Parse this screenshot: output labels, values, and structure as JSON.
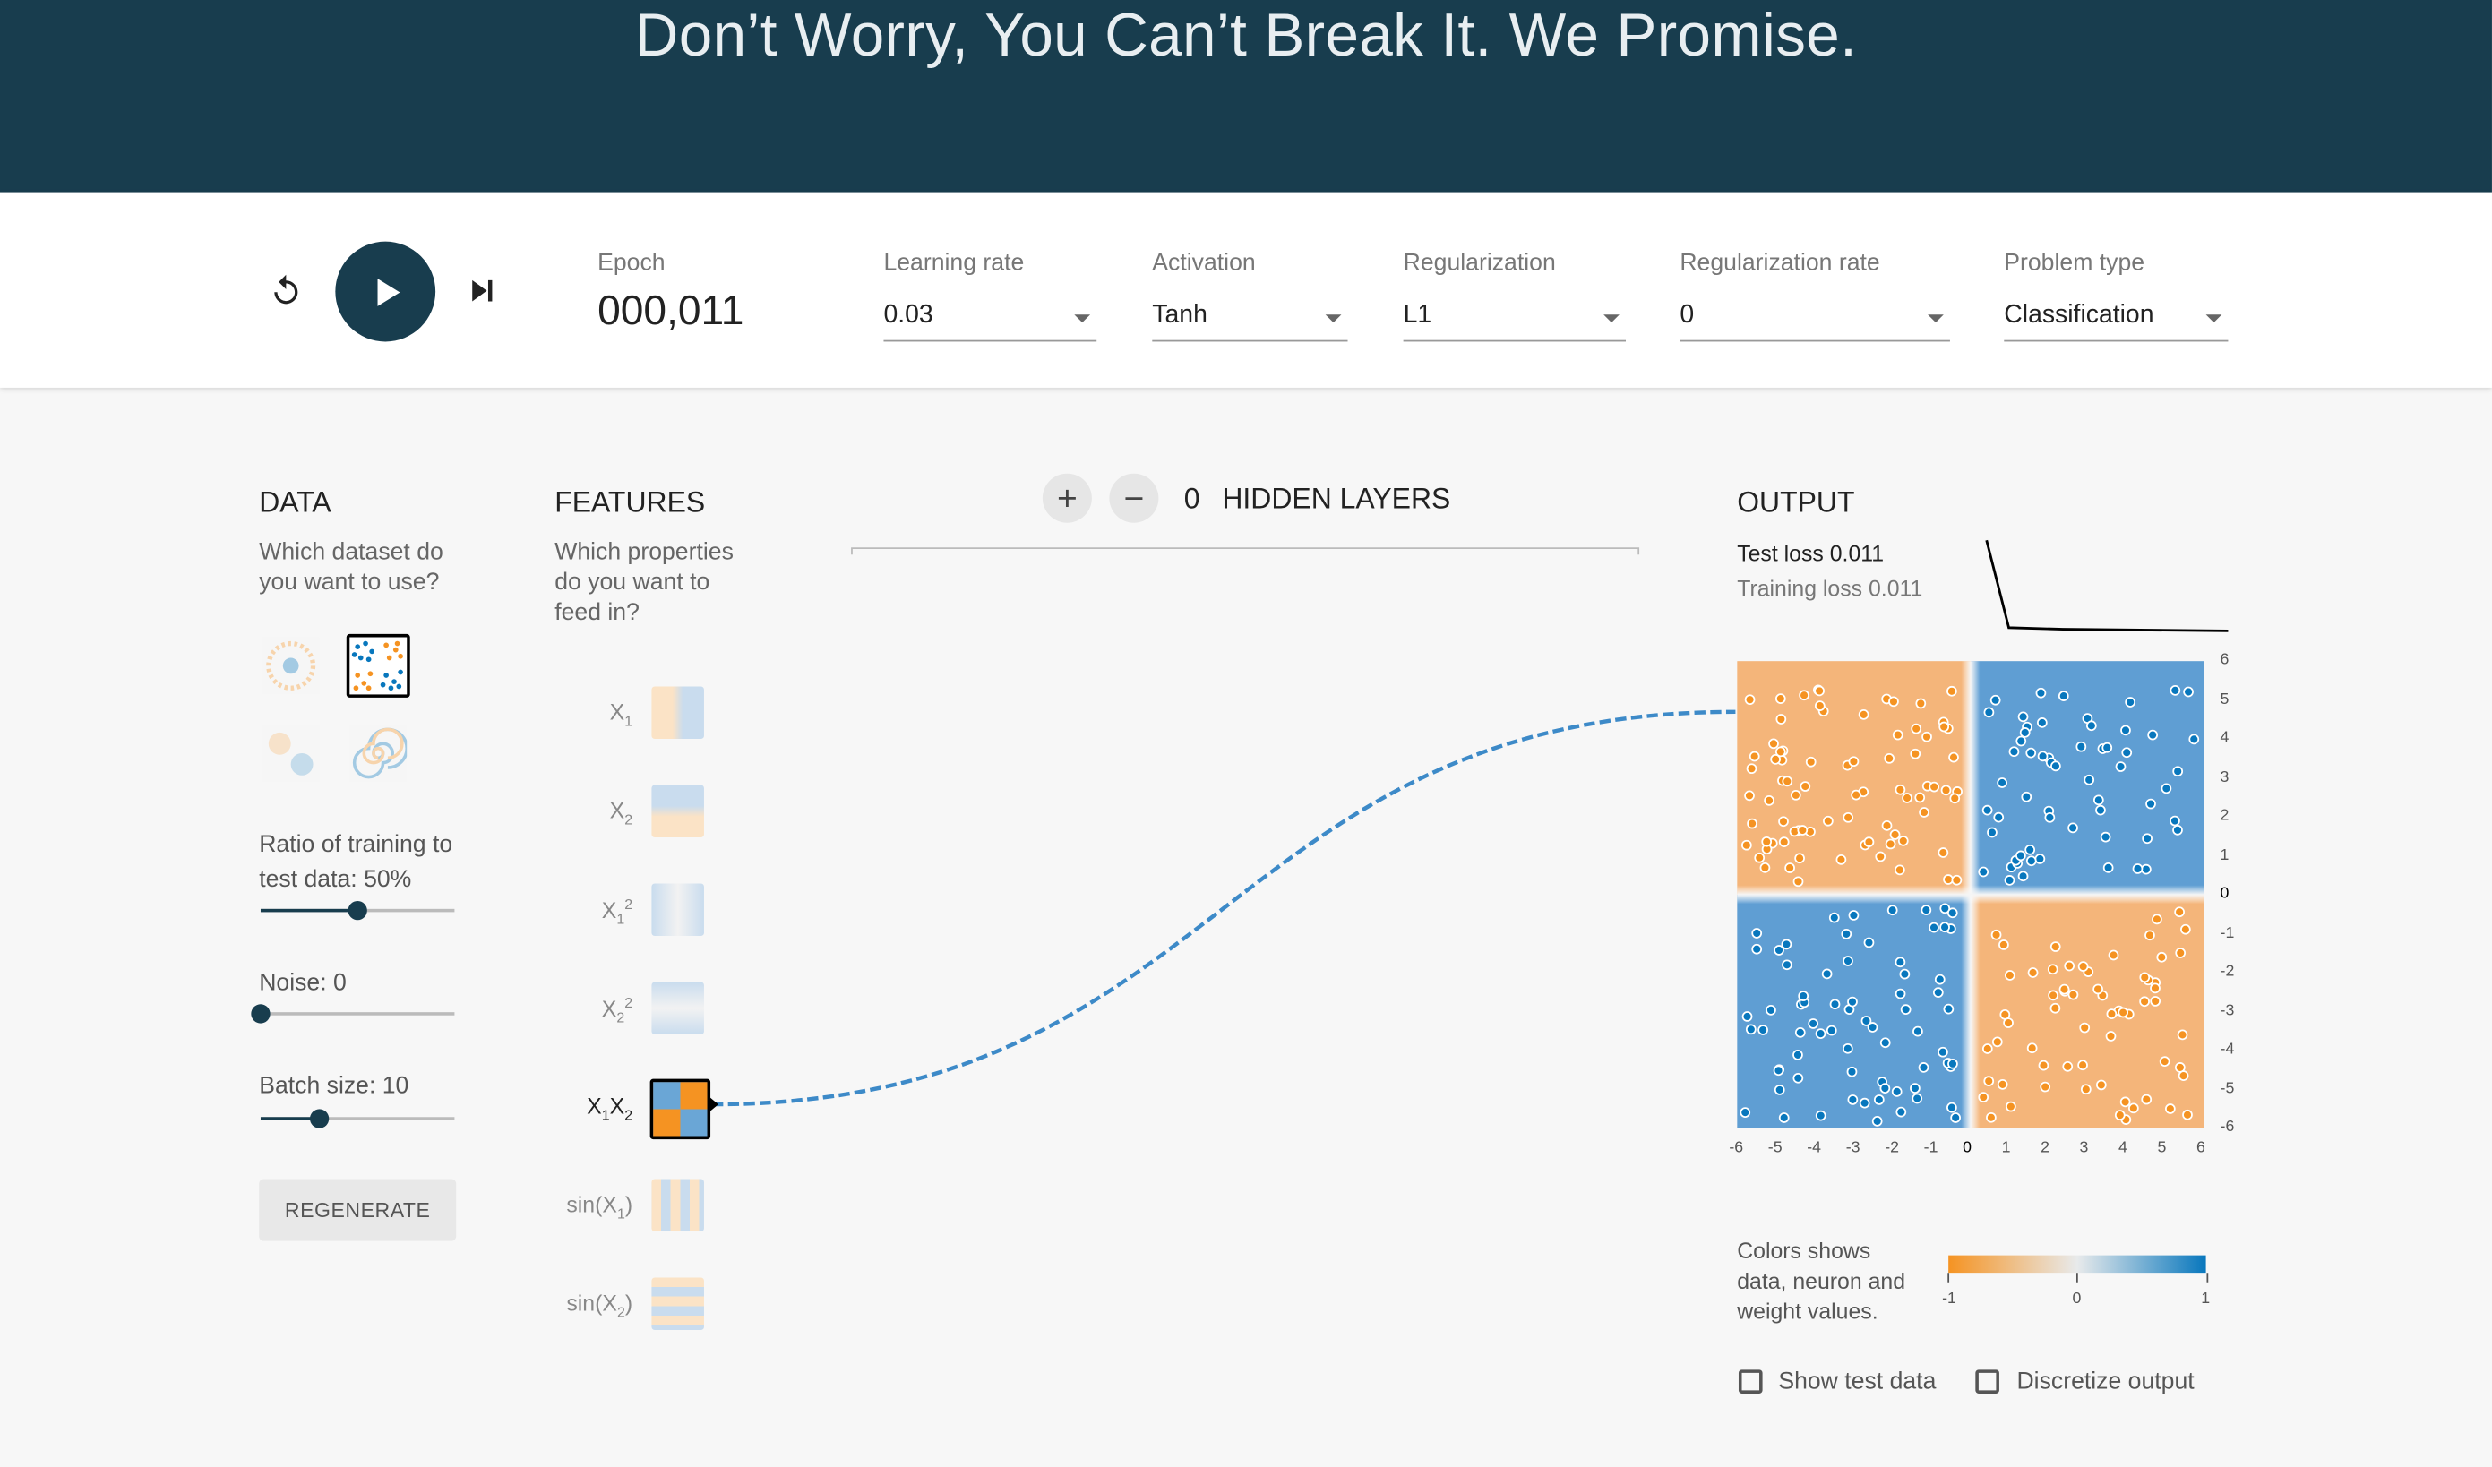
{
  "header": {
    "title": "Don’t Worry, You Can’t Break It. We Promise."
  },
  "controls": {
    "epoch_label": "Epoch",
    "epoch_value": "000,011",
    "learning_rate_label": "Learning rate",
    "learning_rate_value": "0.03",
    "activation_label": "Activation",
    "activation_value": "Tanh",
    "regularization_label": "Regularization",
    "regularization_value": "L1",
    "regularization_rate_label": "Regularization rate",
    "regularization_rate_value": "0",
    "problem_type_label": "Problem type",
    "problem_type_value": "Classification"
  },
  "data_panel": {
    "title": "DATA",
    "subtitle_line1": "Which dataset do",
    "subtitle_line2": "you want to use?",
    "ratio_label_line1": "Ratio of training to",
    "ratio_label_line2": "test data:  50%",
    "ratio_value": 0.5,
    "noise_label": "Noise:  0",
    "noise_value": 0,
    "batch_label": "Batch size:  10",
    "batch_value": 0.3,
    "regenerate_label": "REGENERATE"
  },
  "features_panel": {
    "title": "FEATURES",
    "subtitle_line1": "Which properties",
    "subtitle_line2": "do you want to",
    "subtitle_line3": "feed in?"
  },
  "network": {
    "hidden_layers_count": "0",
    "hidden_layers_label": "HIDDEN LAYERS"
  },
  "output_panel": {
    "title": "OUTPUT",
    "test_loss": "Test loss 0.011",
    "training_loss": "Training loss 0.011",
    "x_ticks": [
      "-6",
      "-5",
      "-4",
      "-3",
      "-2",
      "-1",
      "0",
      "1",
      "2",
      "3",
      "4",
      "5",
      "6"
    ],
    "y_ticks": [
      "6",
      "5",
      "4",
      "3",
      "2",
      "1",
      "0",
      "-1",
      "-2",
      "-3",
      "-4",
      "-5",
      "-6"
    ],
    "legend_line1": "Colors shows",
    "legend_line2": "data, neuron and",
    "legend_line3": "weight values.",
    "legend_min": "-1",
    "legend_mid": "0",
    "legend_max": "1",
    "show_test_label": "Show test data",
    "discretize_label": "Discretize output"
  },
  "colors": {
    "orange": "#f59322",
    "blue": "#0877bd",
    "navy": "#183d4e"
  }
}
